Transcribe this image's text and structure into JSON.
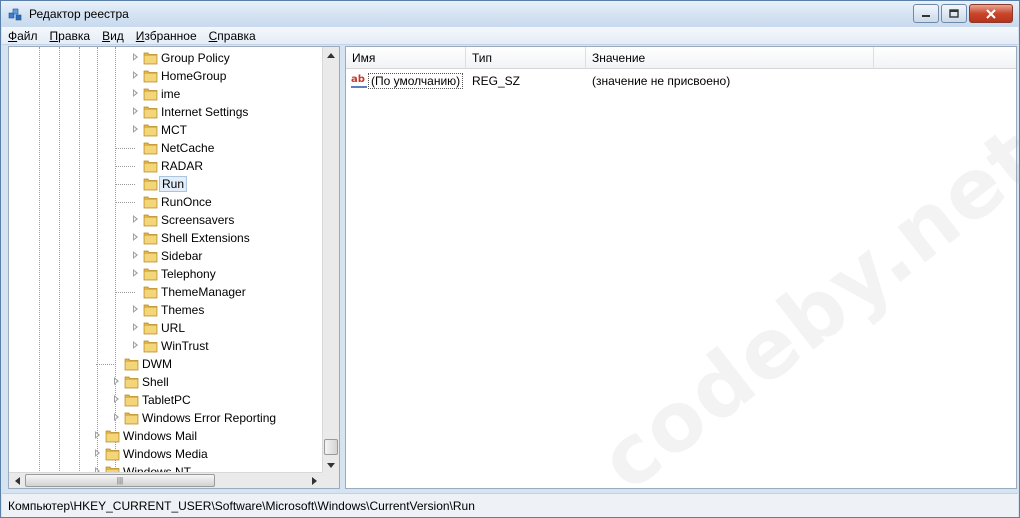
{
  "window": {
    "title": "Редактор реестра"
  },
  "menu": [
    {
      "label_u": "Ф",
      "label_rest": "айл"
    },
    {
      "label_u": "П",
      "label_rest": "равка"
    },
    {
      "label_u": "В",
      "label_rest": "ид"
    },
    {
      "label_u": "И",
      "label_rest": "збранное"
    },
    {
      "label_u": "С",
      "label_rest": "правка"
    }
  ],
  "tree": {
    "nodes": [
      {
        "label": "Group Policy"
      },
      {
        "label": "HomeGroup"
      },
      {
        "label": "ime"
      },
      {
        "label": "Internet Settings"
      },
      {
        "label": "MCT"
      },
      {
        "label": "NetCache"
      },
      {
        "label": "RADAR"
      },
      {
        "label": "Run"
      },
      {
        "label": "RunOnce"
      },
      {
        "label": "Screensavers"
      },
      {
        "label": "Shell Extensions"
      },
      {
        "label": "Sidebar"
      },
      {
        "label": "Telephony"
      },
      {
        "label": "ThemeManager"
      },
      {
        "label": "Themes"
      },
      {
        "label": "URL"
      },
      {
        "label": "WinTrust"
      },
      {
        "label": "DWM"
      },
      {
        "label": "Shell"
      },
      {
        "label": "TabletPC"
      },
      {
        "label": "Windows Error Reporting"
      },
      {
        "label": "Windows Mail"
      },
      {
        "label": "Windows Media"
      },
      {
        "label": "Windows NT"
      }
    ]
  },
  "list": {
    "columns": [
      "Имя",
      "Тип",
      "Значение"
    ],
    "rows": [
      {
        "name": "(По умолчанию)",
        "type": "REG_SZ",
        "value": "(значение не присвоено)"
      }
    ]
  },
  "watermark": "codeby.net",
  "status": {
    "path": "Компьютер\\HKEY_CURRENT_USER\\Software\\Microsoft\\Windows\\CurrentVersion\\Run"
  },
  "colors": {
    "folder": "#e9c25a",
    "selection": "#e4eef9"
  }
}
